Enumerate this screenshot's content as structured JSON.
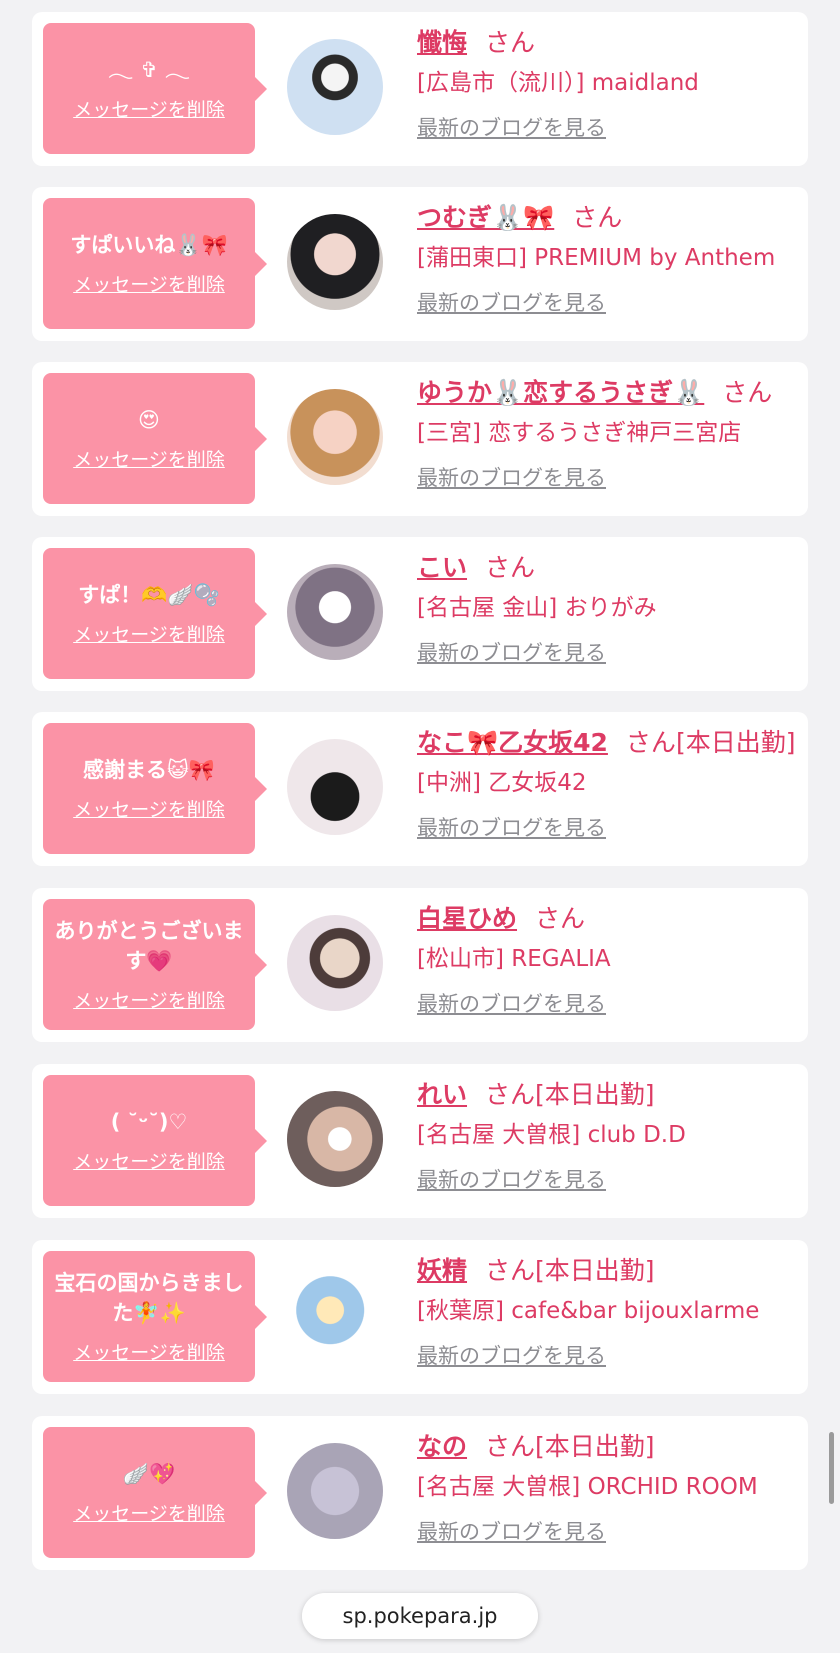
{
  "colors": {
    "accent": "#dd3b64",
    "bubble": "#fb93a6",
    "muted": "#8d8d92",
    "background": "#f2f2f4"
  },
  "labels": {
    "delete_message": "メッセージを削除",
    "latest_blog": "最新のブログを見る",
    "honorific": "さん",
    "on_duty": "[本日出勤]"
  },
  "browser": {
    "url": "sp.pokepara.jp"
  },
  "entries": [
    {
      "message": "𓂃 ✞ 𓂃",
      "name": "懺悔",
      "status": "",
      "shop": "[広島市（流川）] maidland",
      "avatar": "maid-photo"
    },
    {
      "message": "すぱいいね🐰🎀",
      "name": "つむぎ🐰🎀",
      "status": "",
      "shop": "[蒲田東口] PREMIUM by Anthem",
      "avatar": "portrait-photo"
    },
    {
      "message": "😍",
      "name": "ゆうか🐰恋するうさぎ🐰",
      "status": "",
      "shop": "[三宮] 恋するうさぎ神戸三宮店",
      "avatar": "portrait-photo"
    },
    {
      "message": "すぱ！🫶🪽🫧",
      "name": "こい",
      "status": "",
      "shop": "[名古屋 金山] おりがみ",
      "avatar": "portrait-photo"
    },
    {
      "message": "感謝まる😺🎀",
      "name": "なこ🎀乙女坂42",
      "status": "[本日出勤]",
      "shop": "[中洲] 乙女坂42",
      "avatar": "logo-portrait"
    },
    {
      "message": "ありがとうございます💗",
      "name": "白星ひめ",
      "status": "",
      "shop": "[松山市] REGALIA",
      "avatar": "regalia-photo"
    },
    {
      "message": "( ˘ᵕ˘)♡",
      "name": "れい",
      "status": "[本日出勤]",
      "shop": "[名古屋 大曽根] club D.D",
      "avatar": "portrait-photo"
    },
    {
      "message": "宝石の国からきました🧚✨",
      "name": "妖精",
      "status": "[本日出勤]",
      "shop": "[秋葉原] cafe&bar bijouxlarme",
      "avatar": "fairy-illustration"
    },
    {
      "message": "🪽💖",
      "name": "なの",
      "status": "[本日出勤]",
      "shop": "[名古屋 大曽根] ORCHID ROOM",
      "avatar": "blurred-photo"
    }
  ]
}
